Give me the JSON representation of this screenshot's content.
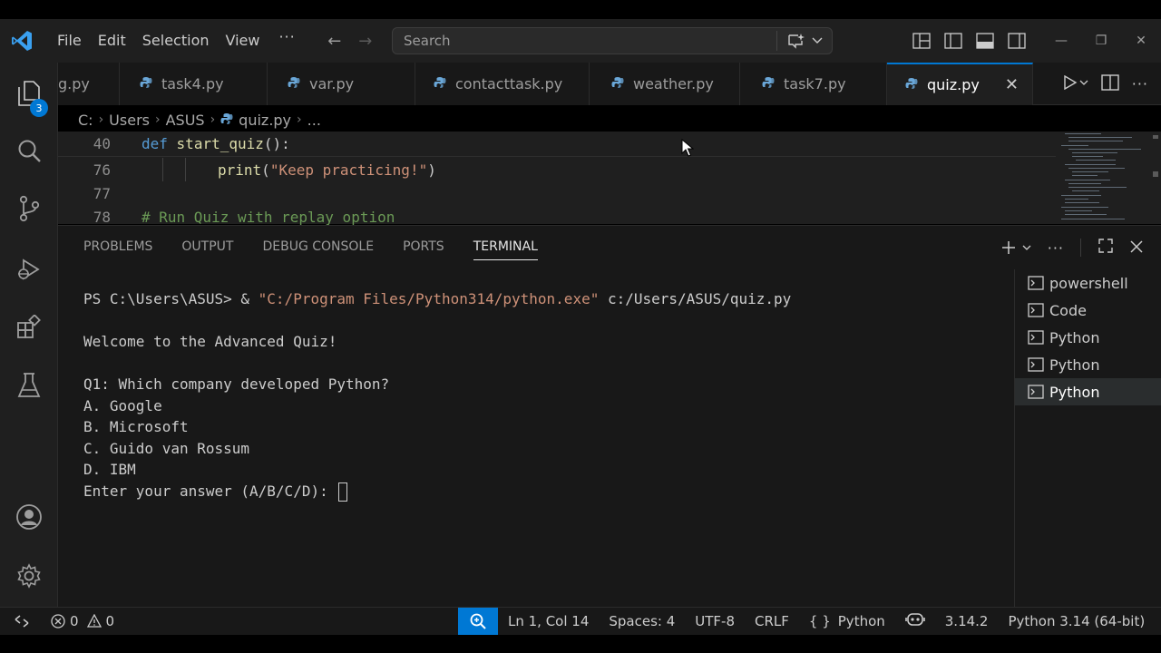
{
  "menu": [
    "File",
    "Edit",
    "Selection",
    "View"
  ],
  "search": {
    "placeholder": "Search"
  },
  "activity_badge": "3",
  "tabs": [
    {
      "label": "g.py"
    },
    {
      "label": "task4.py"
    },
    {
      "label": "var.py"
    },
    {
      "label": "contacttask.py"
    },
    {
      "label": "weather.py"
    },
    {
      "label": "task7.py"
    },
    {
      "label": "quiz.py",
      "active": true
    }
  ],
  "breadcrumb": [
    "C:",
    "Users",
    "ASUS",
    "quiz.py",
    "..."
  ],
  "editor": {
    "lines": [
      {
        "num": "40"
      },
      {
        "num": "76"
      },
      {
        "num": "77"
      },
      {
        "num": "78"
      }
    ],
    "l40": {
      "kw": "def",
      "fn": "start_quiz",
      "rest": "():"
    },
    "l76": {
      "fn": "print",
      "open": "(",
      "str": "\"Keep practicing!\"",
      "close": ")"
    },
    "l78": {
      "comment": "# Run Quiz with replay option"
    }
  },
  "panel": {
    "tabs": [
      "PROBLEMS",
      "OUTPUT",
      "DEBUG CONSOLE",
      "PORTS",
      "TERMINAL"
    ],
    "active_tab": "TERMINAL"
  },
  "terminal": {
    "prompt": "PS C:\\Users\\ASUS> & ",
    "exe": "\"C:/Program Files/Python314/python.exe\"",
    "script": " c:/Users/ASUS/quiz.py",
    "welcome": "Welcome to the Advanced Quiz!",
    "question": "Q1: Which company developed Python?",
    "options": [
      "A. Google",
      "B. Microsoft",
      "C. Guido van Rossum",
      "D. IBM"
    ],
    "input_prompt": "Enter your answer (A/B/C/D): "
  },
  "terminal_list": [
    "powershell",
    "Code",
    "Python",
    "Python",
    "Python"
  ],
  "status": {
    "errors": "0",
    "warnings": "0",
    "position": "Ln 1, Col 14",
    "spaces": "Spaces: 4",
    "encoding": "UTF-8",
    "eol": "CRLF",
    "language": "Python",
    "py_version": "3.14.2",
    "interpreter": "Python 3.14 (64-bit)"
  },
  "colors": {
    "accent": "#0078d4",
    "keyword": "#569cd6",
    "function": "#dcdcaa",
    "string": "#ce9178",
    "comment": "#6a9955"
  }
}
